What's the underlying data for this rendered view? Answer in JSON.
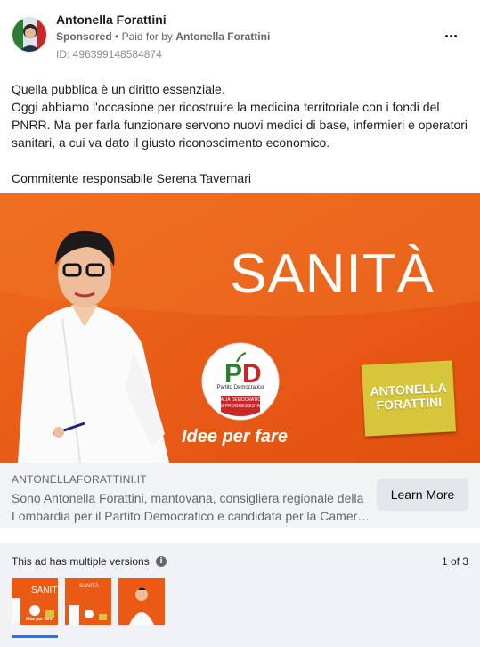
{
  "advertiser": {
    "name": "Antonella Forattini",
    "sponsored_label": "Sponsored",
    "separator": "•",
    "paid_for_by_prefix": "Paid for by",
    "paid_for_by_name": "Antonella Forattini",
    "ad_id": "ID: 496399148584874"
  },
  "ad_text": {
    "line1": "Quella pubblica è un diritto essenziale.",
    "line2": "Oggi abbiamo l'occasione per ricostruire la medicina territoriale con i fondi del PNRR. Ma per farla funzionare servono nuovi medici di base, infermieri e operatori sanitari, a cui va dato il giusto riconoscimento economico.",
    "line3": "Commitente responsabile Serena Tavernari"
  },
  "creative": {
    "title": "SANITÀ",
    "slogan": "Idee per fare",
    "logo_party_initials": "PD",
    "logo_party_name": "Partito Democratico",
    "logo_band_text_1": "ITALIA DEMOCRATICA",
    "logo_band_text_2": "E PROGRESSISTA",
    "sticky_line1": "ANTONELLA",
    "sticky_line2": "FORATTINI",
    "background_color": "#ea5a14",
    "sticky_color": "#d7c63a"
  },
  "link": {
    "domain": "ANTONELLAFORATTINI.IT",
    "description": "Sono Antonella Forattini, mantovana, consigliera regionale della Lombardia per il Partito Democratico e candidata per la Camera dei Deputati",
    "cta_label": "Learn More"
  },
  "versions": {
    "label": "This ad has multiple versions",
    "info_icon": "info-icon",
    "pager": "1 of 3",
    "thumbs": [
      {
        "title": "SANITÀ",
        "slogan": "Idee per fare"
      },
      {
        "title": "SANITÀ"
      },
      {
        "title": ""
      }
    ]
  }
}
